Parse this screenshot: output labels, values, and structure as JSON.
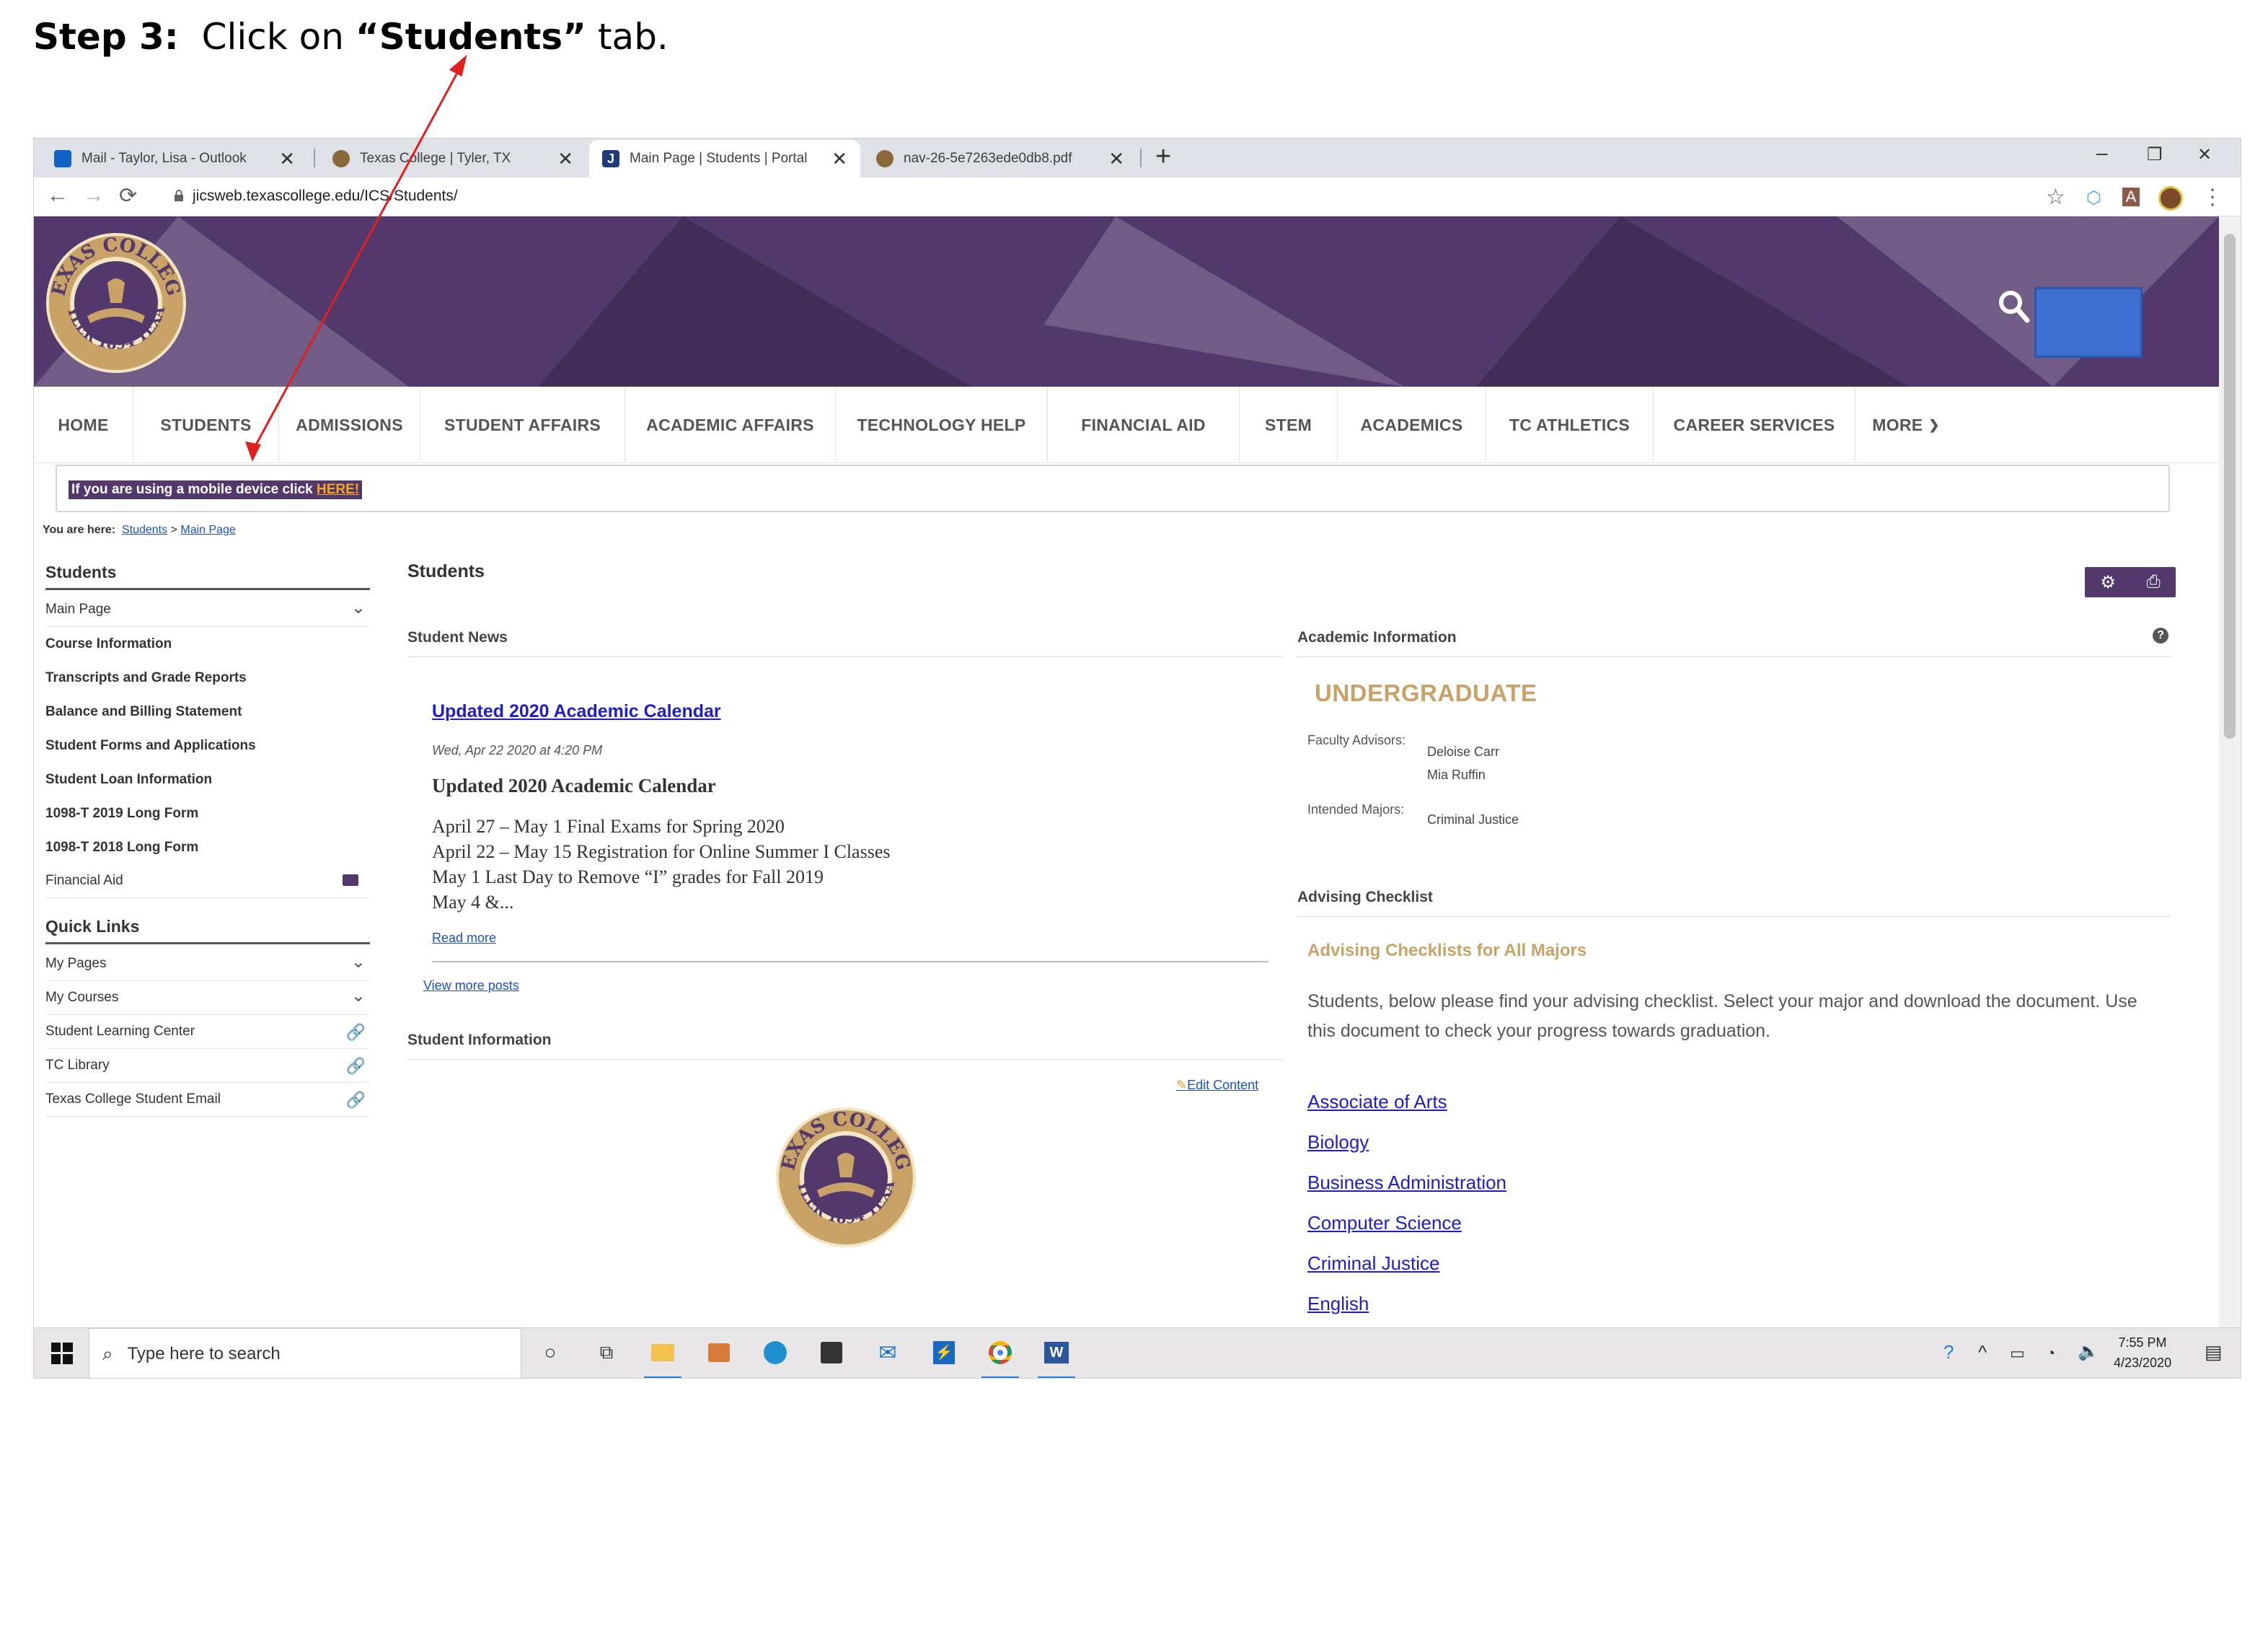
{
  "instruction": {
    "step": "Step 3:",
    "pre": "Click on",
    "target": "“Students”",
    "post": "tab."
  },
  "browser": {
    "tabs": [
      {
        "label": "Mail - Taylor, Lisa - Outlook",
        "icon": "outlook-icon",
        "color": "#0f62c7"
      },
      {
        "label": "Texas College | Tyler, TX",
        "icon": "texas-college-seal-icon",
        "color": "#8a6a3b"
      },
      {
        "label": "Main Page | Students | Portal",
        "icon": "jenzabar-icon",
        "color": "#1e3a78",
        "active": true
      },
      {
        "label": "nav-26-5e7263ede0db8.pdf",
        "icon": "texas-college-seal-icon",
        "color": "#8a6a3b"
      }
    ],
    "url": "jicsweb.texascollege.edu/ICS/Students/",
    "new_tab": "+",
    "window_controls": [
      "–",
      "❐",
      "✕"
    ]
  },
  "site": {
    "colors": {
      "brand_purple": "#52386b",
      "gold": "#c8a266",
      "link_blue": "#1d4fc4",
      "search_blue": "#3d6fd0"
    },
    "logo_text": "TEXAS COLLEGE TYLER 1894 TEXAS",
    "nav": [
      "HOME",
      "STUDENTS",
      "ADMISSIONS",
      "STUDENT AFFAIRS",
      "ACADEMIC AFFAIRS",
      "TECHNOLOGY HELP",
      "FINANCIAL AID",
      "STEM",
      "ACADEMICS",
      "TC ATHLETICS",
      "CAREER SERVICES",
      "MORE"
    ],
    "mobile_notice": "If you are using a mobile device click ",
    "mobile_here": "HERE!",
    "breadcrumb": {
      "prefix": "You are here:",
      "crumb1": "Students",
      "sep": ">",
      "crumb2": "Main Page"
    }
  },
  "sidebar": {
    "students_header": "Students",
    "students_items": [
      {
        "label": "Main Page",
        "icon": "chevron-down-icon",
        "bold": false
      },
      {
        "label": "Course Information",
        "bold": true
      },
      {
        "label": "Transcripts and Grade Reports",
        "bold": true
      },
      {
        "label": "Balance and Billing Statement",
        "bold": true
      },
      {
        "label": "Student Forms and Applications",
        "bold": true
      },
      {
        "label": "Student Loan Information",
        "bold": true
      },
      {
        "label": "1098-T 2019 Long Form",
        "bold": true
      },
      {
        "label": "1098-T 2018 Long Form",
        "bold": true
      },
      {
        "label": "Financial Aid",
        "icon": "folder-icon",
        "bold": false
      }
    ],
    "quick_links_header": "Quick Links",
    "quick_links": [
      {
        "label": "My Pages",
        "icon": "chevron-down-icon"
      },
      {
        "label": "My Courses",
        "icon": "chevron-down-icon"
      },
      {
        "label": "Student Learning Center",
        "icon": "link-icon"
      },
      {
        "label": "TC Library",
        "icon": "link-icon"
      },
      {
        "label": "Texas College Student Email",
        "icon": "link-icon"
      }
    ]
  },
  "main": {
    "title": "Students",
    "student_news": {
      "header": "Student News",
      "post_link": "Updated 2020 Academic Calendar",
      "post_date": "Wed, Apr 22 2020 at 4:20 PM",
      "post_title": "Updated 2020 Academic Calendar",
      "post_lines": [
        "April 27 – May 1   Final Exams for Spring 2020",
        "April 22 – May 15   Registration for Online Summer I Classes",
        "May 1   Last Day to Remove “I” grades for Fall 2019",
        "May 4  &..."
      ],
      "read_more": "Read more",
      "view_more": "View more posts"
    },
    "student_information": {
      "header": "Student Information",
      "edit_content": "Edit Content"
    },
    "academic_information": {
      "header": "Academic Information",
      "level": "UNDERGRADUATE",
      "faculty_label": "Faculty Advisors:",
      "advisors": [
        "Deloise Carr",
        "Mia Ruffin"
      ],
      "majors_label": "Intended Majors:",
      "majors": [
        "Criminal Justice"
      ]
    },
    "advising": {
      "header": "Advising Checklist",
      "subheader": "Advising Checklists for All Majors",
      "text": "Students, below please find your advising checklist.  Select your major and download the document.  Use this document to check your progress towards graduation.",
      "links": [
        "Associate of Arts",
        "Biology",
        "Business Administration",
        "Computer Science",
        "Criminal Justice",
        "English"
      ]
    }
  },
  "taskbar": {
    "search_placeholder": "Type here to search",
    "time": "7:55 PM",
    "date": "4/23/2020",
    "icons": [
      "cortana-icon",
      "task-view-icon",
      "file-explorer-icon",
      "media-player-icon",
      "edge-icon",
      "store-icon",
      "mail-icon",
      "powershell-icon",
      "chrome-icon",
      "word-icon"
    ]
  }
}
